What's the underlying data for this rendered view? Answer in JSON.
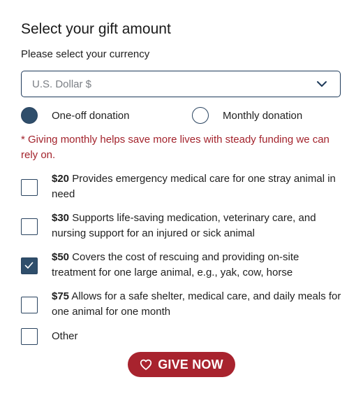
{
  "heading": "Select your gift amount",
  "currency": {
    "label": "Please select your currency",
    "selected": "U.S. Dollar $"
  },
  "frequency": {
    "options": [
      {
        "label": "One-off donation",
        "selected": true
      },
      {
        "label": "Monthly donation",
        "selected": false
      }
    ],
    "note": "* Giving monthly helps save more lives with steady funding we can rely on."
  },
  "amounts": [
    {
      "amount": "$20",
      "description": "Provides emergency medical care for one stray animal in need",
      "checked": false
    },
    {
      "amount": "$30",
      "description": "Supports life-saving medication, veterinary care, and nursing support for an injured or sick animal",
      "checked": false
    },
    {
      "amount": "$50",
      "description": "Covers the cost of rescuing and providing on-site treatment for one large animal, e.g., yak, cow, horse",
      "checked": true
    },
    {
      "amount": "$75",
      "description": "Allows for a safe shelter, medical care, and daily meals for one animal for one month",
      "checked": false
    },
    {
      "amount": "",
      "description": "Other",
      "checked": false
    }
  ],
  "cta": {
    "label": "GIVE NOW",
    "icon": "heart-icon"
  },
  "colors": {
    "accent": "#a8232e",
    "primary": "#2f4e6b",
    "note": "#a3232c"
  }
}
